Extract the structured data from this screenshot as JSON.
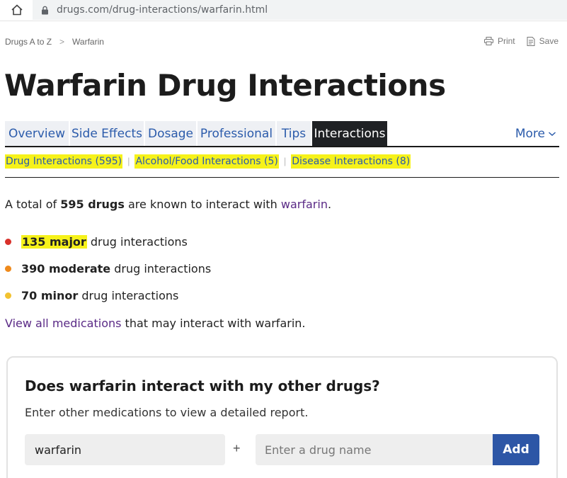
{
  "browser": {
    "url": "drugs.com/drug-interactions/warfarin.html"
  },
  "breadcrumb": {
    "items": [
      "Drugs A to Z",
      "Warfarin"
    ],
    "separator": ">"
  },
  "tools": {
    "print_label": "Print",
    "save_label": "Save"
  },
  "page_title": "Warfarin Drug Interactions",
  "tabs": [
    {
      "label": "Overview",
      "active": false
    },
    {
      "label": "Side Effects",
      "active": false
    },
    {
      "label": "Dosage",
      "active": false
    },
    {
      "label": "Professional",
      "active": false
    },
    {
      "label": "Tips",
      "active": false
    },
    {
      "label": "Interactions",
      "active": true
    }
  ],
  "more_label": "More",
  "subnav": {
    "items": [
      "Drug Interactions (595)",
      "Alcohol/Food Interactions (5)",
      "Disease Interactions (8)"
    ],
    "separator": "|",
    "highlight_color": "#f6f21a"
  },
  "summary": {
    "prefix": "A total of ",
    "count": "595 drugs",
    "middle": " are known to interact with ",
    "drug_link": "warfarin",
    "suffix": "."
  },
  "severity": [
    {
      "count": "135 major",
      "rest": " drug interactions",
      "color": "#d9312b"
    },
    {
      "count": "390 moderate",
      "rest": " drug interactions",
      "color": "#ef8a1c"
    },
    {
      "count": "70 minor",
      "rest": " drug interactions",
      "color": "#f2c230"
    }
  ],
  "view_all": {
    "link": "View all medications",
    "rest": " that may interact with warfarin."
  },
  "checker": {
    "title": "Does warfarin interact with my other drugs?",
    "description": "Enter other medications to view a detailed report.",
    "current_drug": "warfarin",
    "plus": "+",
    "placeholder": "Enter a drug name",
    "add_label": "Add"
  },
  "colors": {
    "link": "#2b5bab",
    "visited_link": "#5a2a86",
    "active_tab": "#1f2124",
    "tab_bg": "#eef0f4",
    "button": "#2d56a6"
  }
}
